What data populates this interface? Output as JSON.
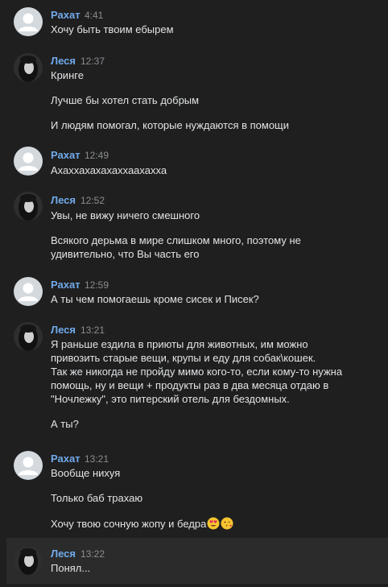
{
  "messages": [
    {
      "author": "Рахат",
      "time": "4:41",
      "avatar": "default-avatar",
      "lines": [
        "Хочу быть твоим ебырем"
      ]
    },
    {
      "author": "Леся",
      "time": "12:37",
      "avatar": "photo-avatar",
      "lines": [
        "Кринге",
        "Лучше бы хотел стать добрым",
        "И людям помогал, которые нуждаются в помощи"
      ]
    },
    {
      "author": "Рахат",
      "time": "12:49",
      "avatar": "default-avatar",
      "lines": [
        "Ахаххахахахаххаахахха"
      ]
    },
    {
      "author": "Леся",
      "time": "12:52",
      "avatar": "photo-avatar",
      "lines": [
        "Увы, не вижу ничего смешного",
        "Всякого дерьма в мире слишком много, поэтому не",
        "удивительно, что Вы часть его"
      ]
    },
    {
      "author": "Рахат",
      "time": "12:59",
      "avatar": "default-avatar",
      "lines": [
        "А ты чем помогаешь кроме сисек и Писек?"
      ]
    },
    {
      "author": "Леся",
      "time": "13:21",
      "avatar": "photo-avatar",
      "lines": [
        "Я раньше ездила в приюты для животных, им можно",
        "привозить старые вещи, крупы и еду для собак\\кошек.",
        "Так же никогда не пройду мимо кого-то, если кому-то нужна",
        "помощь, ну и вещи + продукты раз в два месяца отдаю в",
        "\"Ночлежку\", это питерский отель для бездомных.",
        "А ты?"
      ]
    },
    {
      "author": "Рахат",
      "time": "13:21",
      "avatar": "default-avatar",
      "lines": [
        "Вообще нихуя",
        "Только баб трахаю",
        "Хочу твою сочную жопу и бедра"
      ],
      "emojis": [
        "heart-eyes-emoji",
        "kissing-emoji"
      ]
    },
    {
      "author": "Леся",
      "time": "13:22",
      "avatar": "photo-avatar",
      "lines": [
        "Понял..."
      ]
    }
  ],
  "colors": {
    "background": "#1f1f1f",
    "highlight": "#2b2b2b",
    "author": "#71aaeb",
    "text": "#e1e3e6",
    "time": "#8a8d91"
  }
}
